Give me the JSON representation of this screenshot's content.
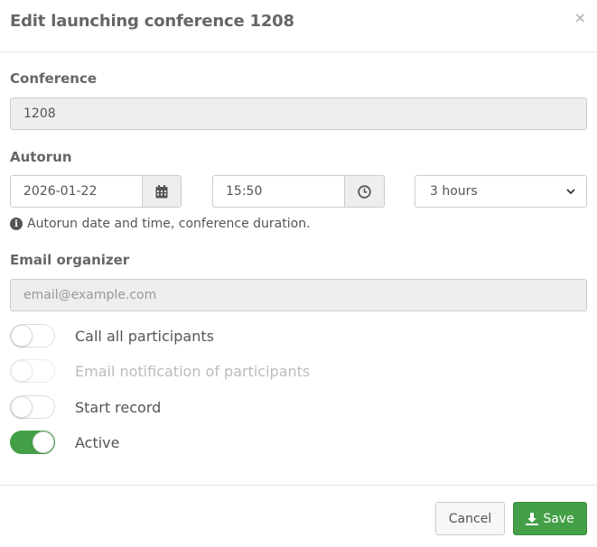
{
  "header": {
    "title": "Edit launching conference 1208",
    "close_symbol": "×"
  },
  "conference": {
    "label": "Conference",
    "value": "1208"
  },
  "autorun": {
    "label": "Autorun",
    "date": "2026-01-22",
    "time": "15:50",
    "duration": "3 hours",
    "help_text": "Autorun date and time, conference duration.",
    "help_icon_glyph": "i"
  },
  "email": {
    "label": "Email organizer",
    "placeholder": "email@example.com"
  },
  "toggles": [
    {
      "label": "Call all participants",
      "on": false,
      "disabled": false
    },
    {
      "label": "Email notification of participants",
      "on": false,
      "disabled": true
    },
    {
      "label": "Start record",
      "on": false,
      "disabled": false
    },
    {
      "label": "Active",
      "on": true,
      "disabled": false
    }
  ],
  "footer": {
    "cancel_label": "Cancel",
    "save_label": "Save"
  },
  "colors": {
    "success": "#43a047",
    "readonly_bg": "#eeeeee"
  }
}
